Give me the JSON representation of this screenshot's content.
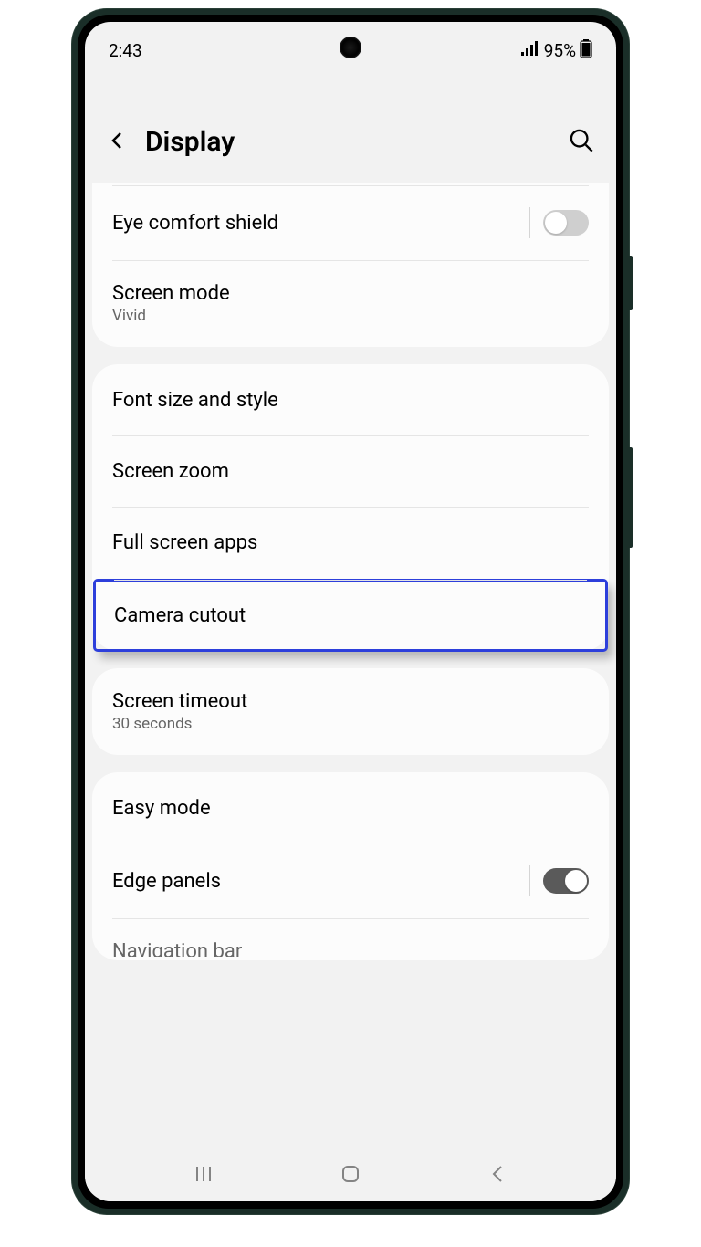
{
  "status": {
    "time": "2:43",
    "battery": "95%"
  },
  "header": {
    "title": "Display"
  },
  "groups": [
    {
      "items": [
        {
          "title": "Eye comfort shield",
          "toggle": "off"
        },
        {
          "title": "Screen mode",
          "subtitle": "Vivid"
        }
      ]
    },
    {
      "items": [
        {
          "title": "Font size and style"
        },
        {
          "title": "Screen zoom"
        },
        {
          "title": "Full screen apps"
        },
        {
          "title": "Camera cutout",
          "highlighted": true
        }
      ]
    },
    {
      "items": [
        {
          "title": "Screen timeout",
          "subtitle": "30 seconds"
        }
      ]
    },
    {
      "items": [
        {
          "title": "Easy mode"
        },
        {
          "title": "Edge panels",
          "toggle": "on"
        },
        {
          "title": "Navigation bar",
          "partial": true
        }
      ]
    }
  ]
}
